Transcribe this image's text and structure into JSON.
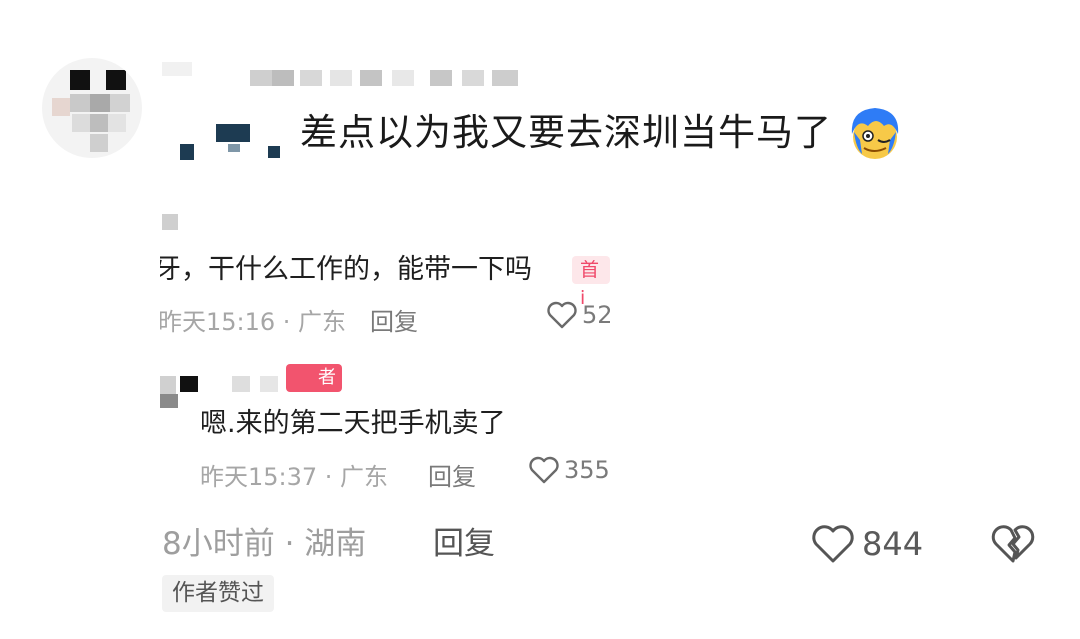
{
  "comment": {
    "text": "差点以为我又要去深圳当牛马了",
    "time_location": "8小时前 · 湖南",
    "reply_label": "回复",
    "like_count": "844",
    "author_liked_label": "作者赞过",
    "emoji": "blue-haired-face-emoji"
  },
  "replies": [
    {
      "text": "牙，干什么工作的，能带一下吗",
      "badge": "首i",
      "time_location": "昨天15:16 · 广东",
      "reply_label": "回复",
      "like_count": "52"
    },
    {
      "text": "嗯.来的第二天把手机卖了",
      "badge": "者",
      "time_location": "昨天15:37 · 广东",
      "reply_label": "回复",
      "like_count": "355"
    }
  ],
  "colors": {
    "badge_pink": "#f2546e",
    "badge_light": "#fde7ea",
    "meta_gray": "#a6a6a6"
  }
}
